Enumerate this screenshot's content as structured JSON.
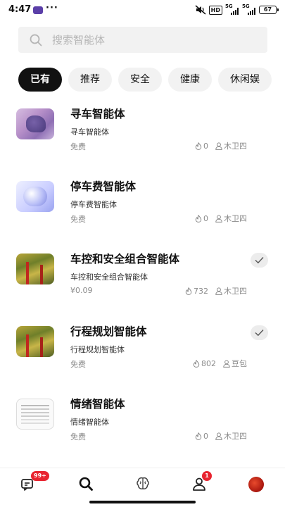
{
  "status_bar": {
    "time": "4:47",
    "dots": "···",
    "hd_label": "HD",
    "signal_labels": [
      "5G",
      "5G"
    ],
    "battery": "67"
  },
  "search": {
    "placeholder": "搜索智能体"
  },
  "tabs": [
    {
      "label": "已有",
      "active": true
    },
    {
      "label": "推荐",
      "active": false
    },
    {
      "label": "安全",
      "active": false
    },
    {
      "label": "健康",
      "active": false
    },
    {
      "label": "休闲娱",
      "active": false
    }
  ],
  "agents": [
    {
      "name": "寻车智能体",
      "desc": "寻车智能体",
      "price": "免费",
      "likes": "0",
      "author": "木卫四",
      "added": false,
      "thumb": "purple-abstract-image"
    },
    {
      "name": "停车费智能体",
      "desc": "停车费智能体",
      "price": "免费",
      "likes": "0",
      "author": "木卫四",
      "added": false,
      "thumb": "blue-device-image"
    },
    {
      "name": "车控和安全组合智能体",
      "desc": "车控和安全组合智能体",
      "price": "¥0.09",
      "likes": "732",
      "author": "木卫四",
      "added": true,
      "thumb": "autumn-forest-image"
    },
    {
      "name": "行程规划智能体",
      "desc": "行程规划智能体",
      "price": "免费",
      "likes": "802",
      "author": "豆包",
      "added": true,
      "thumb": "autumn-forest-image"
    },
    {
      "name": "情绪智能体",
      "desc": "情绪智能体",
      "price": "免费",
      "likes": "0",
      "author": "木卫四",
      "added": false,
      "thumb": "document-image"
    }
  ],
  "bottom_nav": {
    "items": [
      {
        "icon": "chat-icon",
        "badge": "99+"
      },
      {
        "icon": "search-icon",
        "badge": ""
      },
      {
        "icon": "brain-icon",
        "badge": ""
      },
      {
        "icon": "user-icon",
        "badge": "1"
      },
      {
        "icon": "avatar",
        "badge": ""
      }
    ]
  },
  "colors": {
    "accent": "#111111",
    "badge": "#e8242f",
    "muted": "#8a8a8a",
    "chip_bg": "#f2f2f2"
  }
}
